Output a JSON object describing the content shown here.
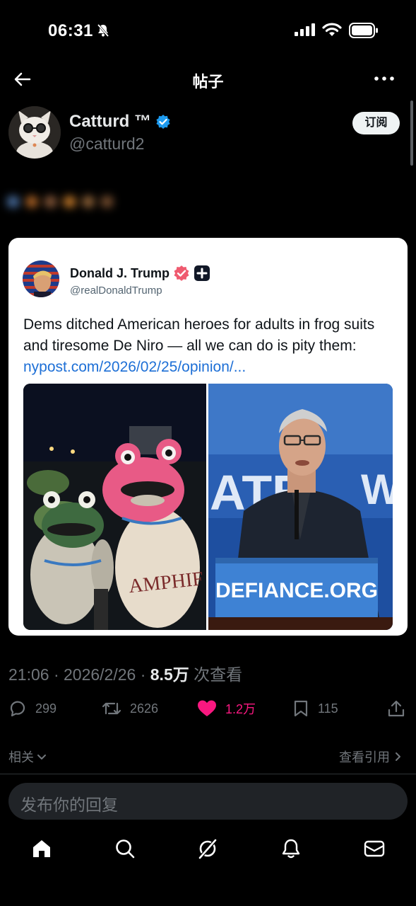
{
  "status_bar": {
    "time": "06:31"
  },
  "nav": {
    "title": "帖子"
  },
  "author": {
    "name": "Catturd ™",
    "handle": "@catturd2",
    "subscribe_label": "订阅"
  },
  "quoted_post": {
    "name": "Donald J. Trump",
    "handle": "@realDonaldTrump",
    "text": "Dems ditched American heroes for adults in frog suits and tiresome De Niro — all we can do is pity them:",
    "link": "nypost.com/2026/02/25/opinion/...",
    "images": {
      "left": {
        "text": "AMPHIF"
      },
      "right": {
        "sign": "DEFIANCE.ORG",
        "banner": "ATE",
        "banner_right": "W"
      }
    }
  },
  "meta": {
    "timestamp": "21:06 · 2026/2/26 · ",
    "views": "8.5万",
    "views_label": " 次查看"
  },
  "actions": {
    "replies": "299",
    "reposts": "2626",
    "likes": "1.2万",
    "bookmarks": "115"
  },
  "related": {
    "label": "相关",
    "quotes_label": "查看引用"
  },
  "reply_box": {
    "placeholder": "发布你的回复"
  },
  "colors": {
    "background": "#000000",
    "like": "#f91880",
    "verified": "#1d9bf0",
    "link": "#1d6fd6"
  }
}
